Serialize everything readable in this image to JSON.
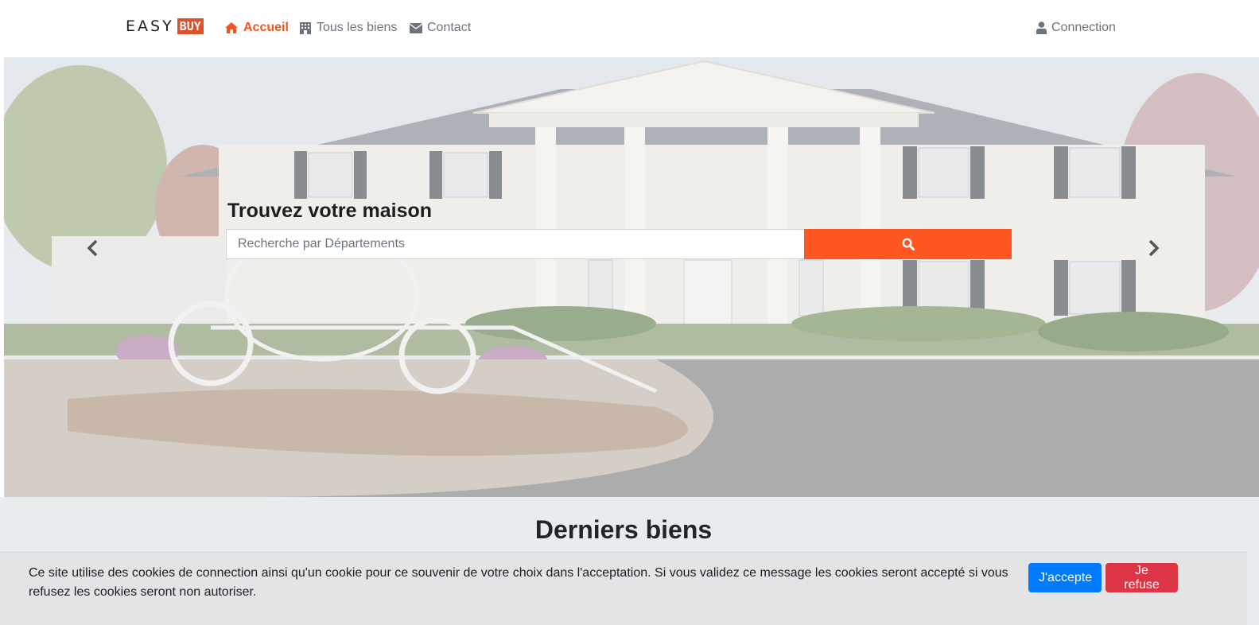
{
  "brand": {
    "part1": "EASY",
    "part2": "BUY"
  },
  "nav": {
    "home": "Accueil",
    "all_properties": "Tous les biens",
    "contact": "Contact",
    "login": "Connection"
  },
  "hero": {
    "title": "Trouvez votre maison",
    "search_placeholder": "Recherche par Départements",
    "search_icon": "search-icon",
    "prev_icon": "chevron-left-icon",
    "next_icon": "chevron-right-icon"
  },
  "latest": {
    "title": "Derniers biens"
  },
  "cookie": {
    "message": "Ce site utilise des cookies de connection ainsi qu'un cookie pour ce souvenir de votre choix dans l'acceptation. Si vous validez ce message les cookies seront accepté si vous refusez les cookies seront non autoriser.",
    "accept": "J'accepte",
    "refuse": "Je refuse"
  },
  "colors": {
    "accent": "#ff5722",
    "nav_active": "#f05522",
    "accept_button": "#007bff",
    "refuse_button": "#dc3545"
  }
}
